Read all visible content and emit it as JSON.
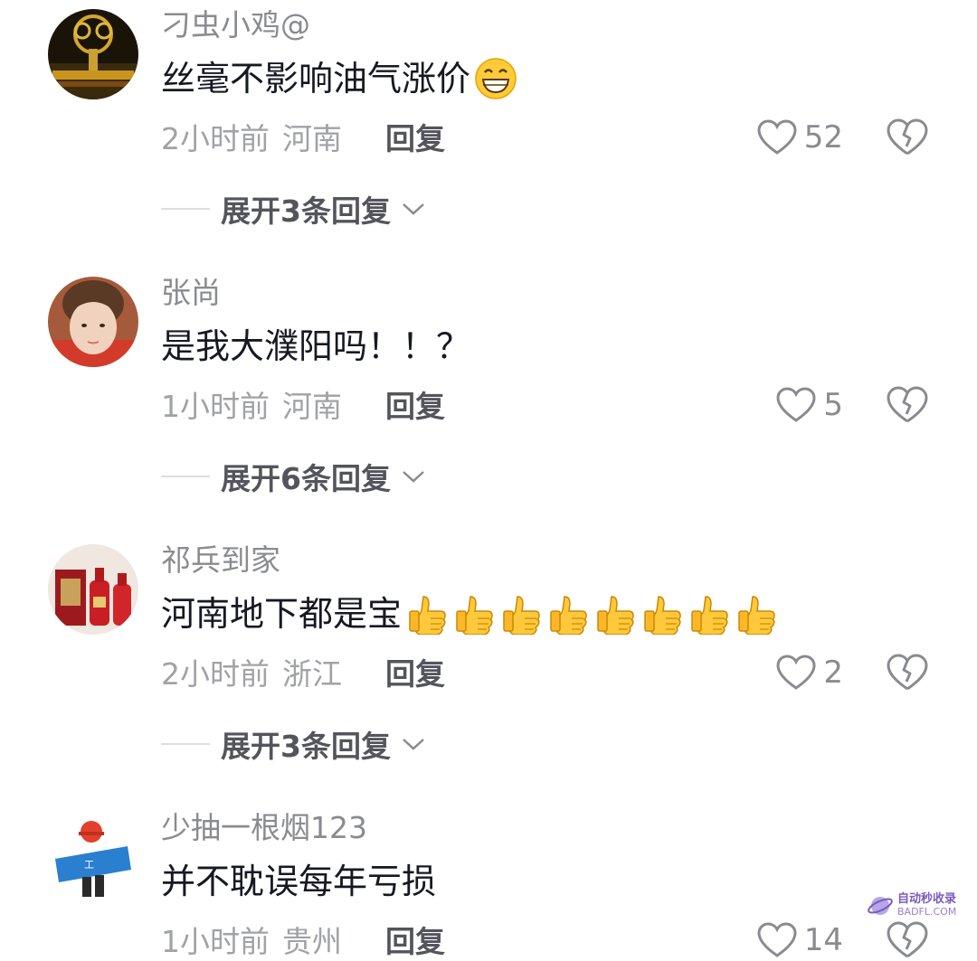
{
  "comments": [
    {
      "username": "刁虫小鸡@",
      "text": "丝毫不影响油气涨价",
      "emoji": "grin-emoji",
      "time": "2小时前",
      "region": "河南",
      "reply_label": "回复",
      "likes": "52",
      "expand_label": "展开3条回复"
    },
    {
      "username": "张尚",
      "text": "是我大濮阳吗！！？",
      "time": "1小时前",
      "region": "河南",
      "reply_label": "回复",
      "likes": "5",
      "expand_label": "展开6条回复"
    },
    {
      "username": "祁兵到家",
      "text": "河南地下都是宝",
      "emoji": "thumbs-up-emoji x8",
      "time": "2小时前",
      "region": "浙江",
      "reply_label": "回复",
      "likes": "2",
      "expand_label": "展开3条回复"
    },
    {
      "username": "少抽一根烟123",
      "text": "并不耽误每年亏损",
      "time": "1小时前",
      "region": "贵州",
      "reply_label": "回复",
      "likes": "14"
    }
  ],
  "watermark": {
    "line1": "自动秒收录",
    "line2": "BADFL.COM"
  },
  "colors": {
    "text_primary": "#161823",
    "text_secondary": "#8a8b91",
    "text_meta": "#a1a2a7"
  }
}
